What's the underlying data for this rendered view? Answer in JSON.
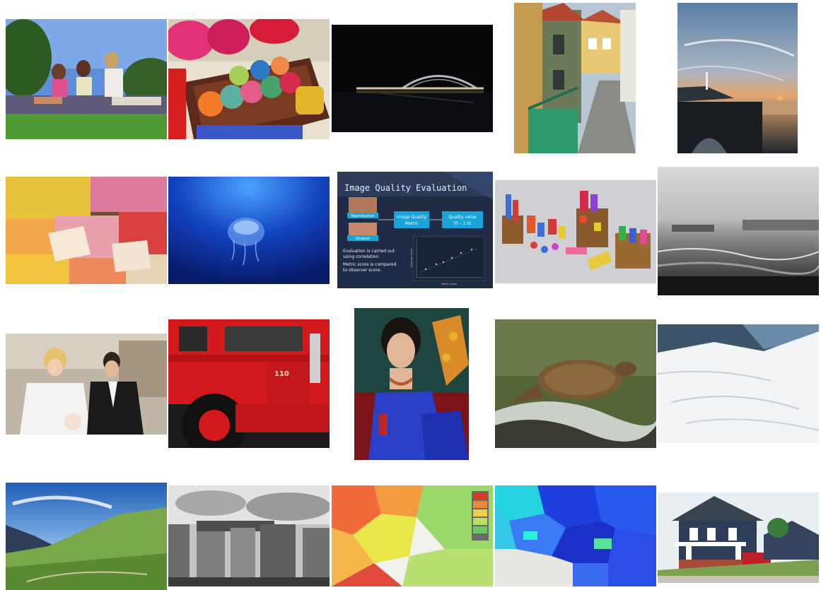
{
  "grid": {
    "rows": 4,
    "columns": 5,
    "image_count": 20
  },
  "images": [
    {
      "subject": "women-picnic"
    },
    {
      "subject": "yarn-box"
    },
    {
      "subject": "night-bridge"
    },
    {
      "subject": "street-houses"
    },
    {
      "subject": "sunset-coast"
    },
    {
      "subject": "flower-market"
    },
    {
      "subject": "jellyfish"
    },
    {
      "subject": "quality-slide"
    },
    {
      "subject": "toy-blocks"
    },
    {
      "subject": "bw-shore"
    },
    {
      "subject": "wedding-couple"
    },
    {
      "subject": "red-truck"
    },
    {
      "subject": "portrait-woman"
    },
    {
      "subject": "sea-turtle"
    },
    {
      "subject": "snow-slope"
    },
    {
      "subject": "mountain-meadow"
    },
    {
      "subject": "stonehenge"
    },
    {
      "subject": "europe-map"
    },
    {
      "subject": "blue-regions-map"
    },
    {
      "subject": "house"
    }
  ],
  "slide": {
    "title": "Image Quality Evaluation",
    "box_reproduction": "Reproduction",
    "box_original": "Original",
    "box_metric_line1": "Image Quality",
    "box_metric_line2": "Metric",
    "box_quality_line1": "Quality value",
    "box_quality_line2": "(0 – 1.0)",
    "body_line1": "Evaluation is carried out",
    "body_line2": "using correlation.",
    "body_line3": "Metric score is compared",
    "body_line4": "to observer score.",
    "plot_xlabel": "Metric Score",
    "plot_ylabel": "Observer Score"
  },
  "truck": {
    "number": "110"
  },
  "colors": {
    "background": "#ffffff",
    "slide_bg": "#1f2a44",
    "slide_box": "#19a4d8",
    "truck_red": "#d4191c",
    "map_blue": "#1d3fe0"
  }
}
